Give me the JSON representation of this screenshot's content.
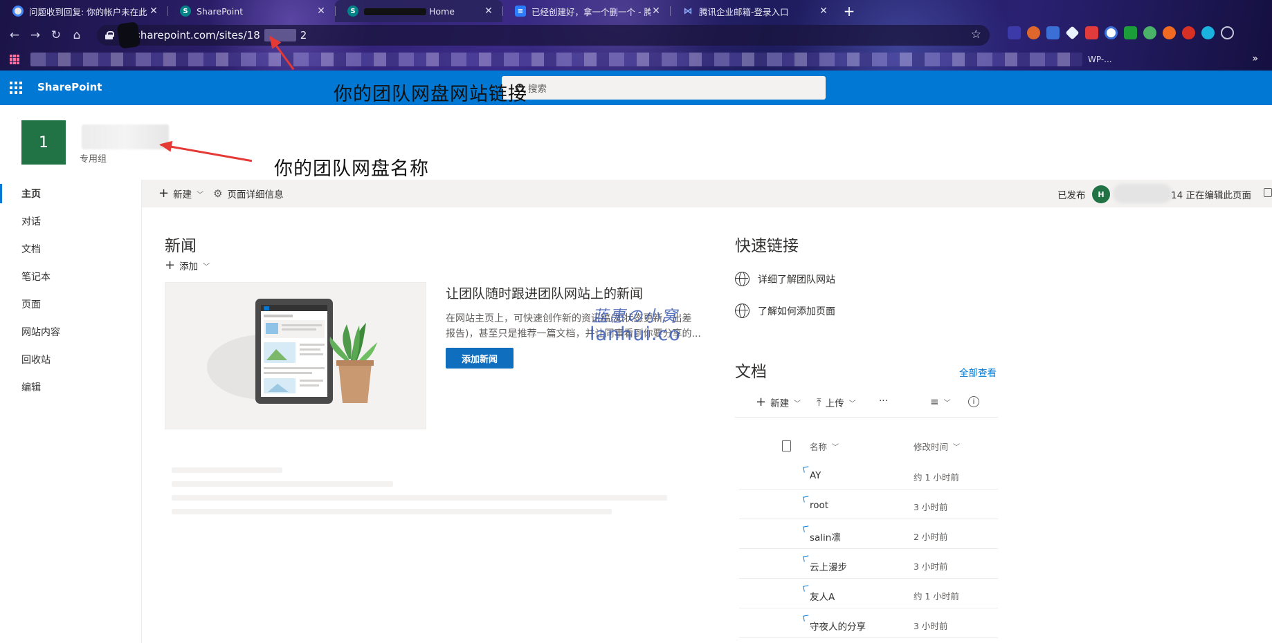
{
  "browser": {
    "tabs": [
      {
        "title": "问题收到回复: 你的帐户未在此",
        "favicon_color": "#4285f4",
        "active": false
      },
      {
        "title": "SharePoint",
        "favicon_color": "#038387",
        "active": false
      },
      {
        "title": "Home",
        "favicon_color": "#038387",
        "active": true
      },
      {
        "title": "已经创建好，拿一个删一个 - 腾",
        "favicon_color": "#2b7cff",
        "active": false
      },
      {
        "title": "腾讯企业邮箱-登录入口",
        "favicon_color": "#6b8cff",
        "active": false
      }
    ],
    "url_prefix": "sharepoint.com/sites/18",
    "url_suffix": "2",
    "bookmark_tail": "WP-..."
  },
  "suitebar": {
    "brand": "SharePoint",
    "search_placeholder": "搜索"
  },
  "annotations": {
    "link": "你的团队网盘网站链接",
    "name": "你的团队网盘名称"
  },
  "site": {
    "logo_text": "1",
    "type": "专用组"
  },
  "leftnav": {
    "items": [
      {
        "label": "主页",
        "selected": true
      },
      {
        "label": "对话"
      },
      {
        "label": "文档"
      },
      {
        "label": "笔记本"
      },
      {
        "label": "页面"
      },
      {
        "label": "网站内容"
      },
      {
        "label": "回收站"
      },
      {
        "label": "编辑"
      }
    ]
  },
  "cmdbar": {
    "new_label": "新建",
    "details_label": "页面详细信息",
    "published": "已发布",
    "avatar_initial": "H",
    "editing": "14 正在编辑此页面"
  },
  "news": {
    "heading": "新闻",
    "add_label": "添加",
    "title": "让团队随时跟进团队网站上的新闻",
    "desc_line1": "在网站主页上，可快速创作新的资讯稿(如状态更新、出差",
    "desc_line2": "报告)，甚至只是推荐一篇文档，并让同事看到你要分享的...",
    "button": "添加新闻"
  },
  "watermark": {
    "line1": "蓝惠の小窝",
    "line2": "lanhui.co"
  },
  "quicklinks": {
    "heading": "快速链接",
    "items": [
      "详细了解团队网站",
      "了解如何添加页面"
    ]
  },
  "documents": {
    "heading": "文档",
    "see_all": "全部查看",
    "new_label": "新建",
    "upload_label": "上传",
    "more": "···",
    "col_name": "名称",
    "col_modified": "修改时间",
    "rows": [
      {
        "name": "AY",
        "time": "约 1 小时前"
      },
      {
        "name": "root",
        "time": "3 小时前"
      },
      {
        "name": "salin凛",
        "time": "2 小时前"
      },
      {
        "name": "云上漫步",
        "time": "3 小时前"
      },
      {
        "name": "友人A",
        "time": "约 1 小时前"
      },
      {
        "name": "守夜人的分享",
        "time": "3 小时前"
      }
    ]
  },
  "colors": {
    "suite_blue": "#0078d4",
    "site_green": "#217346",
    "arrow_red": "#e53935"
  }
}
